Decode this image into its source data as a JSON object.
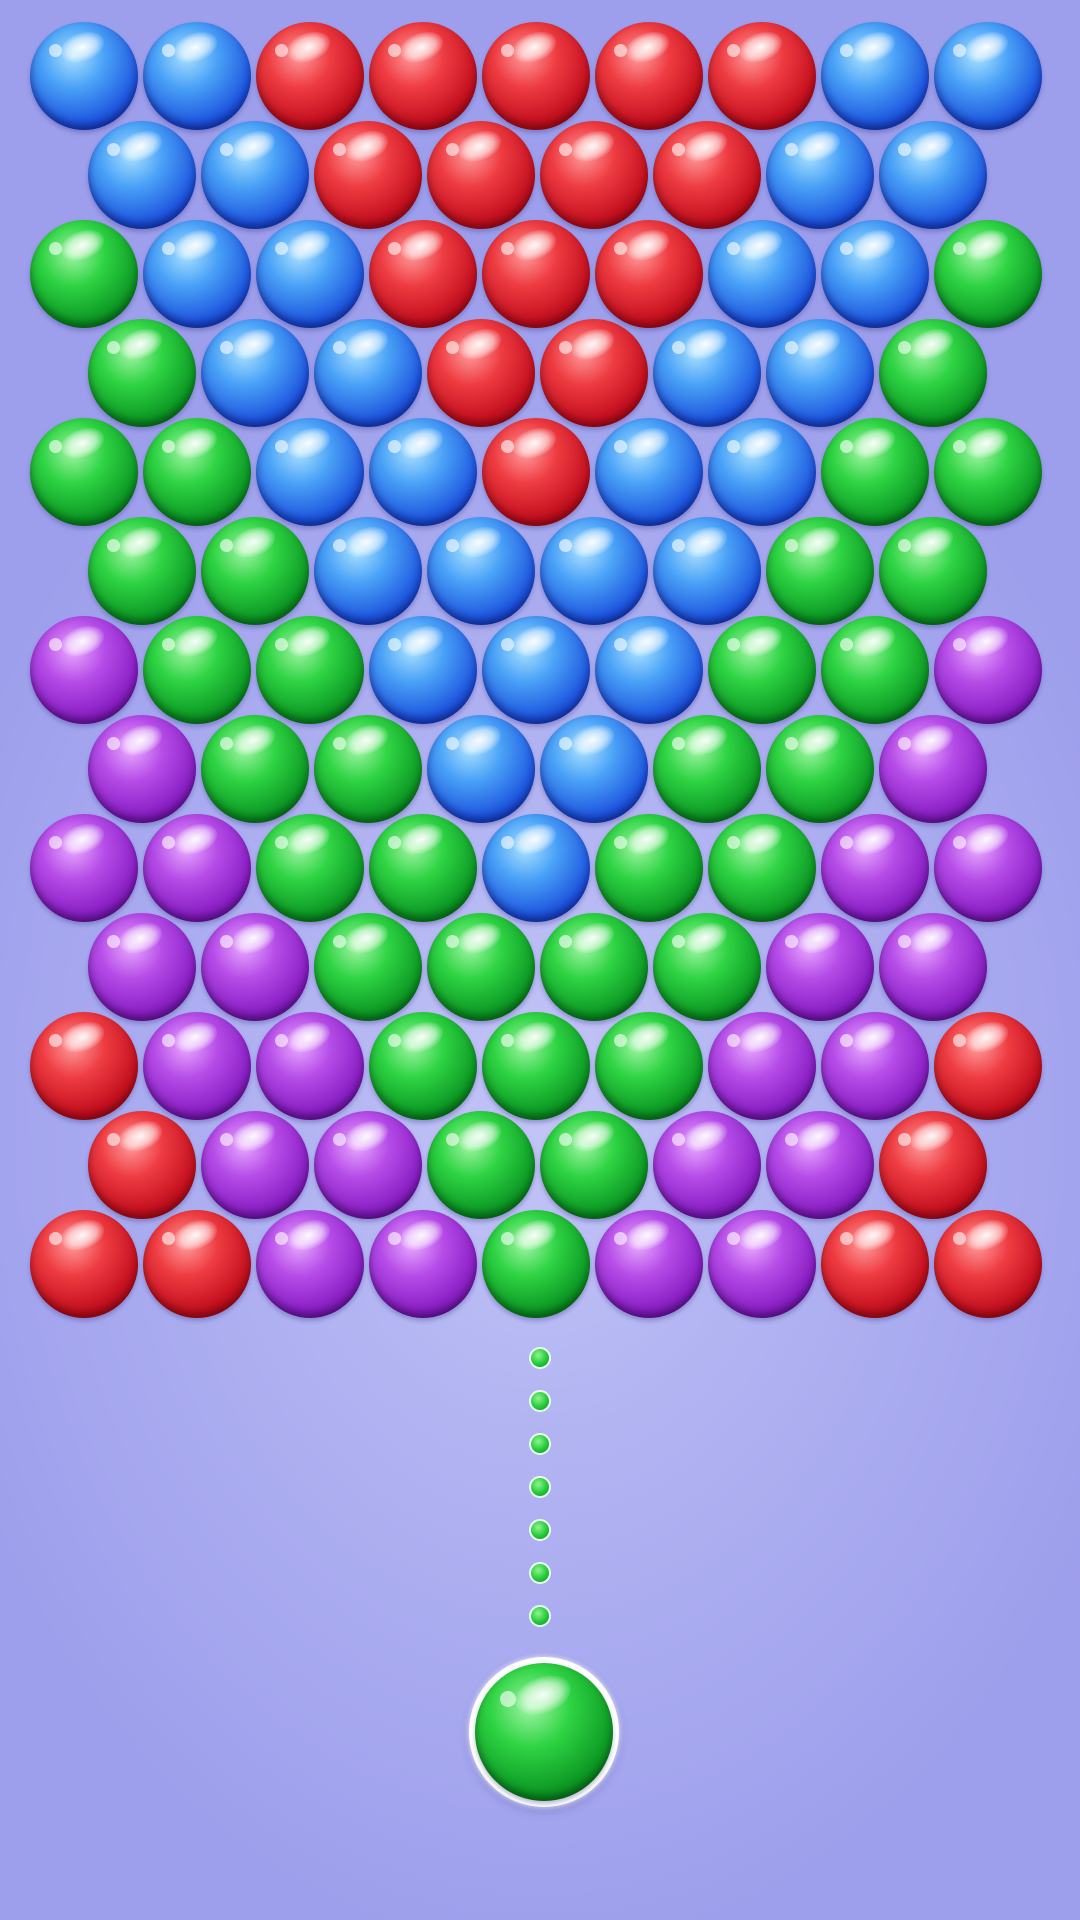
{
  "colors": {
    "background": "#b1b3f2",
    "blue": "#1f58e0",
    "red": "#c4101f",
    "green": "#0d9a25",
    "purple": "#8a1fc4",
    "aim_dot": "#25c93a"
  },
  "bubble_grid": [
    [
      "blue",
      "blue",
      "red",
      "red",
      "red",
      "red",
      "red",
      "blue",
      "blue"
    ],
    [
      "blue",
      "blue",
      "red",
      "red",
      "red",
      "red",
      "blue",
      "blue"
    ],
    [
      "green",
      "blue",
      "blue",
      "red",
      "red",
      "red",
      "blue",
      "blue",
      "green"
    ],
    [
      "green",
      "blue",
      "blue",
      "red",
      "red",
      "blue",
      "blue",
      "green"
    ],
    [
      "green",
      "green",
      "blue",
      "blue",
      "red",
      "blue",
      "blue",
      "green",
      "green"
    ],
    [
      "green",
      "green",
      "blue",
      "blue",
      "blue",
      "blue",
      "green",
      "green"
    ],
    [
      "purple",
      "green",
      "green",
      "blue",
      "blue",
      "blue",
      "green",
      "green",
      "purple"
    ],
    [
      "purple",
      "green",
      "green",
      "blue",
      "blue",
      "green",
      "green",
      "purple"
    ],
    [
      "purple",
      "purple",
      "green",
      "green",
      "blue",
      "green",
      "green",
      "purple",
      "purple"
    ],
    [
      "purple",
      "purple",
      "green",
      "green",
      "green",
      "green",
      "purple",
      "purple"
    ],
    [
      "red",
      "purple",
      "purple",
      "green",
      "green",
      "green",
      "purple",
      "purple",
      "red"
    ],
    [
      "red",
      "purple",
      "purple",
      "green",
      "green",
      "purple",
      "purple",
      "red"
    ],
    [
      "red",
      "red",
      "purple",
      "purple",
      "green",
      "purple",
      "purple",
      "red",
      "red"
    ]
  ],
  "aim_guide": {
    "color": "green",
    "dot_count": 7
  },
  "shooter": {
    "color": "green"
  }
}
